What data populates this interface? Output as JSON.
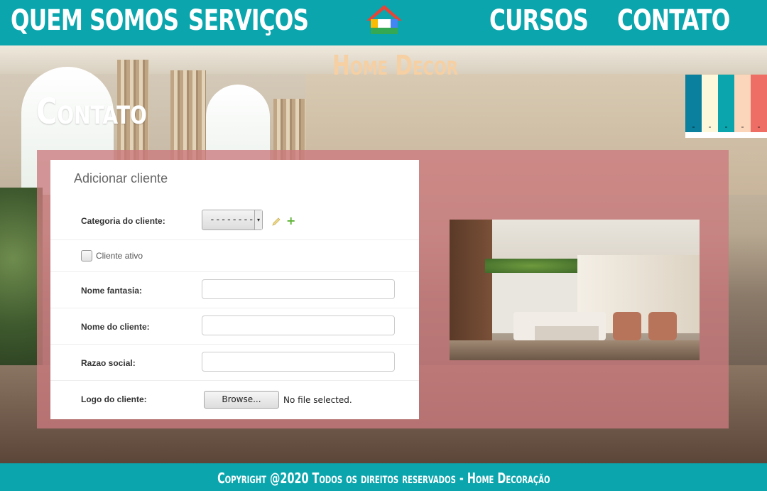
{
  "nav": {
    "items": [
      {
        "label": "QUEM SOMOS"
      },
      {
        "label": "SERVIÇOS"
      },
      {
        "label": "CURSOS"
      },
      {
        "label": "CONTATO"
      }
    ],
    "logo_icon": "house-icon"
  },
  "brand": "Home Decor",
  "page_title": "Contato",
  "palette": {
    "colors": [
      "#0b7f9e",
      "#fdf8dc",
      "#0aa5ad",
      "#fbd6bb",
      "#ee6e66"
    ]
  },
  "form": {
    "heading": "Adicionar cliente",
    "category": {
      "label": "Categoria do cliente:",
      "selected": "---------",
      "edit_icon": "pencil-icon",
      "add_icon": "plus-icon"
    },
    "active": {
      "label": "Cliente ativo",
      "checked": false
    },
    "trade_name": {
      "label": "Nome fantasia:",
      "value": ""
    },
    "client_name": {
      "label": "Nome do cliente:",
      "value": ""
    },
    "company_name": {
      "label": "Razao social:",
      "value": ""
    },
    "logo": {
      "label": "Logo do cliente:",
      "button": "Browse...",
      "status": "No file selected."
    }
  },
  "footer": {
    "text": "Copyright @2020 Todos os direitos reservados - Home Decoração"
  }
}
